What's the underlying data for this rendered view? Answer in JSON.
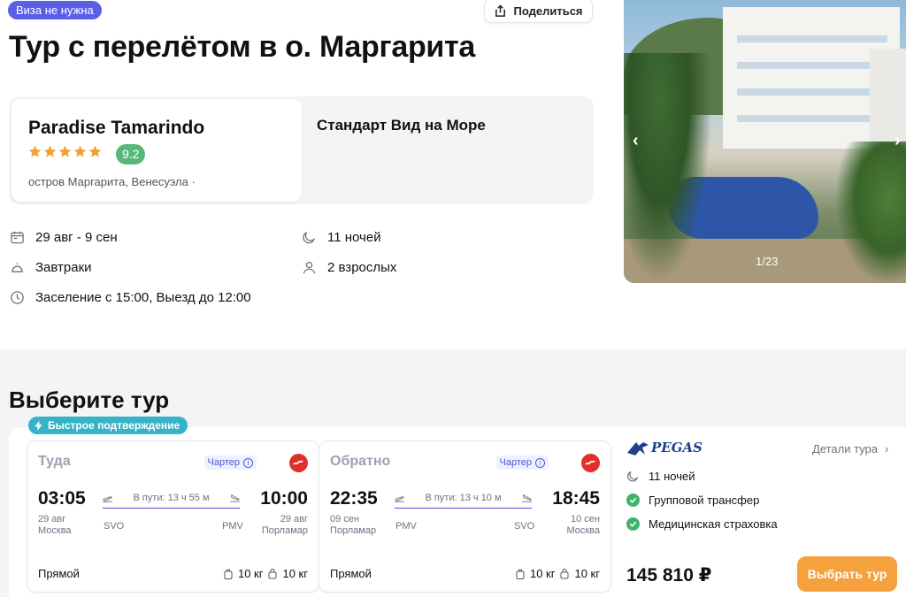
{
  "header": {
    "visa_badge": "Виза не нужна",
    "share_label": "Поделиться",
    "title": "Тур с перелётом в о. Маргарита"
  },
  "hotel": {
    "name": "Paradise Tamarindo",
    "stars": 5,
    "rating": "9.2",
    "location": "остров Маргарита, Венесуэла ·",
    "room_type": "Стандарт Вид на Море"
  },
  "trip_info": {
    "dates": "29 авг - 9 сен",
    "nights": "11 ночей",
    "meals": "Завтраки",
    "guests": "2 взрослых",
    "checkin": "Заселение с 15:00, Выезд до 12:00"
  },
  "gallery": {
    "counter": "1/23",
    "prev_icon": "chevron-left-icon",
    "next_icon": "chevron-right-icon"
  },
  "select_tour": {
    "title": "Выберите тур",
    "fast_badge": "Быстрое подтверждение",
    "flights": [
      {
        "direction": "Туда",
        "charter": "Чартер",
        "dep_time": "03:05",
        "dep_date": "29 авг",
        "dep_city": "Москва",
        "dep_code": "SVO",
        "duration": "В пути: 13 ч 55 м",
        "arr_time": "10:00",
        "arr_date": "29 авг",
        "arr_city": "Порламар",
        "arr_code": "PMV",
        "type": "Прямой",
        "bag1": "10 кг",
        "bag2": "10 кг"
      },
      {
        "direction": "Обратно",
        "charter": "Чартер",
        "dep_time": "22:35",
        "dep_date": "09 сен",
        "dep_city": "Порламар",
        "dep_code": "PMV",
        "duration": "В пути: 13 ч 10 м",
        "arr_time": "18:45",
        "arr_date": "10 сен",
        "arr_city": "Москва",
        "arr_code": "SVO",
        "type": "Прямой",
        "bag1": "10 кг",
        "bag2": "10 кг"
      }
    ],
    "operator": "PEGAS",
    "details_link": "Детали тура",
    "nights": "11 ночей",
    "transfer": "Групповой трансфер",
    "insurance": "Медицинская страховка",
    "price": "145 810 ₽",
    "choose_button": "Выбрать тур"
  },
  "colors": {
    "visa_badge": "#5b5fe8",
    "rating": "#58b87b",
    "fast_badge": "#35b4c8",
    "choose_button": "#f5a13e",
    "airline": "#e0302c",
    "check": "#3fb26b"
  }
}
